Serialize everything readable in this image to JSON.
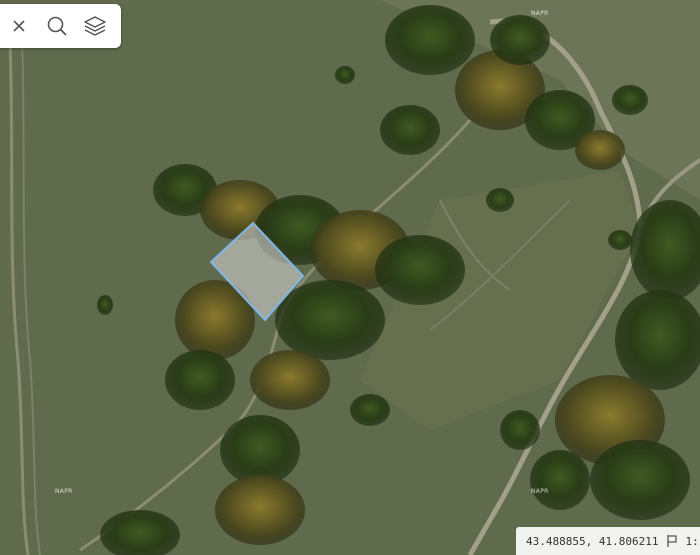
{
  "toolbar": {
    "close_icon": "close-icon",
    "search_icon": "search-icon",
    "layers_icon": "layers-icon"
  },
  "map": {
    "watermark": "NAPR",
    "parcel_color": "#7fb6e6"
  },
  "status": {
    "coordinates": "43.488855, 41.806211",
    "scale": "1:"
  }
}
